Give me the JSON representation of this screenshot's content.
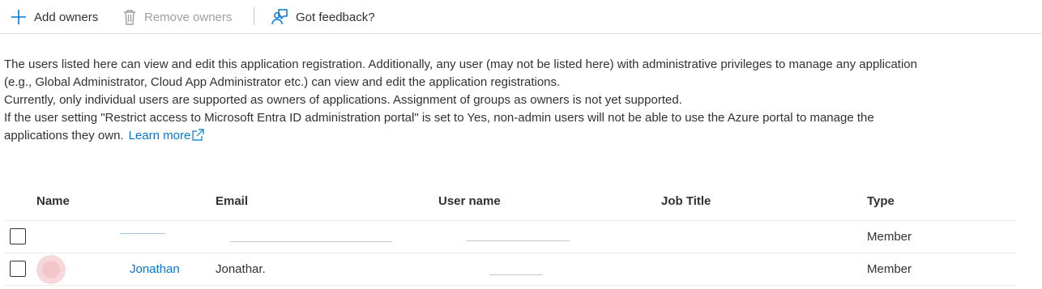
{
  "toolbar": {
    "add_owners": "Add owners",
    "remove_owners": "Remove owners",
    "feedback": "Got feedback?"
  },
  "description": {
    "line1": "The users listed here can view and edit this application registration. Additionally, any user (may not be listed here) with administrative privileges to manage any application",
    "line2": "(e.g., Global Administrator, Cloud App Administrator etc.) can view and edit the application registrations.",
    "line3": "Currently, only individual users are supported as owners of applications. Assignment of groups as owners is not yet supported.",
    "line4": "If the user setting \"Restrict access to Microsoft Entra ID administration portal\" is set to Yes, non-admin users will not be able to use the Azure portal to manage the",
    "line5": "applications they own.",
    "learn_more": "Learn more"
  },
  "table": {
    "columns": [
      "Name",
      "Email",
      "User name",
      "Job Title",
      "Type"
    ],
    "rows": [
      {
        "name": "",
        "email": "",
        "user_name": "",
        "job_title": "",
        "type": "Member"
      },
      {
        "name": "Jonathan",
        "email": "Jonathar.",
        "user_name": "",
        "job_title": "",
        "type": "Member"
      }
    ]
  },
  "colors": {
    "link": "#0078d4",
    "text": "#323130",
    "disabled": "#a19f9d",
    "divider": "#e1dfdd",
    "avatar": "#f6d8dc"
  },
  "icons": {
    "add": "plus-icon",
    "remove": "trash-icon",
    "feedback": "feedback-icon",
    "external": "external-link-icon"
  }
}
